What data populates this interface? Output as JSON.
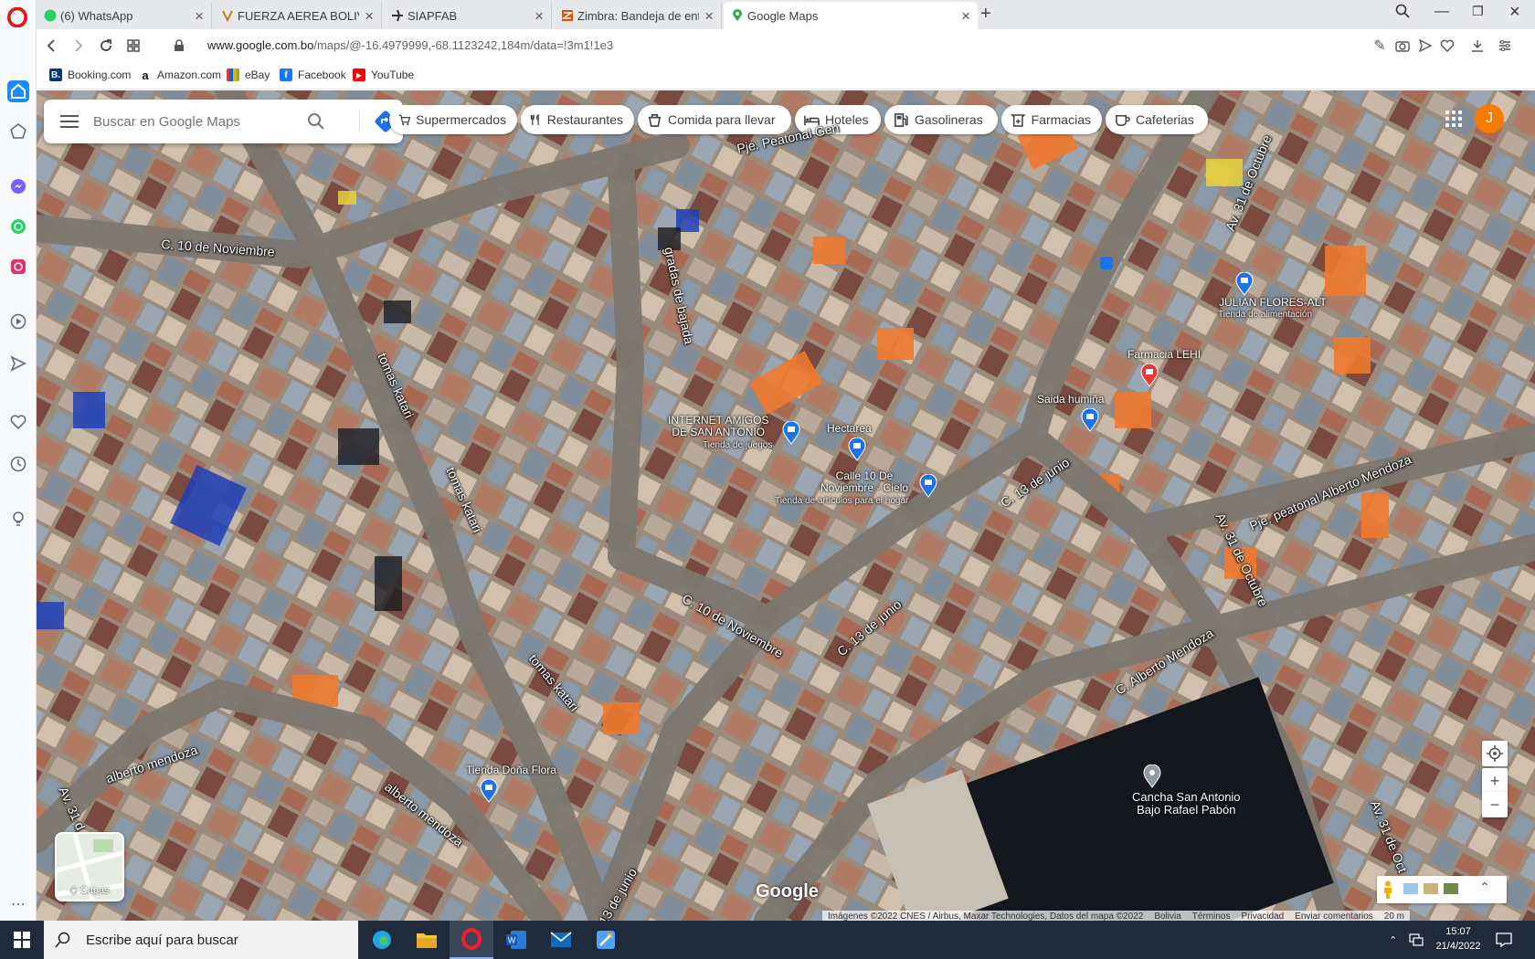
{
  "browser": {
    "tabs": [
      {
        "title": "(6) WhatsApp",
        "badge": "6"
      },
      {
        "title": "FUERZA AEREA BOLIVIANA"
      },
      {
        "title": "SIAPFAB"
      },
      {
        "title": "Zimbra: Bandeja de entrada"
      },
      {
        "title": "Google Maps"
      }
    ],
    "url_host": "www.google.com.bo",
    "url_path": "/maps/@-16.4979999,-68.1123242,184m/data=!3m1!1e3",
    "bookmarks": [
      "Booking.com",
      "Amazon.com",
      "eBay",
      "Facebook",
      "YouTube"
    ]
  },
  "maps": {
    "search_placeholder": "Buscar en Google Maps",
    "chips": [
      "Supermercados",
      "Restaurantes",
      "Comida para llevar",
      "Hoteles",
      "Gasolineras",
      "Farmacias",
      "Cafeterias"
    ],
    "avatar_letter": "J",
    "streets": {
      "pje_peatonal_top": "Pje. Peatonal Gen",
      "c10_nov_top": "C. 10 de Noviembre",
      "gradas": "gradas de bajada",
      "tomas1": "tomas katari",
      "tomas2": "tomas katari",
      "tomas3": "tomas katari",
      "av31_top": "Av. 31 de Octubre",
      "av31_mid": "Av. 31 de Octubre",
      "av31_right": "Av. 31 de Oct",
      "av31_left": "Av. 31 d",
      "c13_a": "C. 13 de junio",
      "c13_b": "C. 13 de junio",
      "c13_bottom": "13 de junio",
      "c10_nov_mid": "C. 10 de Noviembre",
      "pje_alberto": "Pje. peatonal Alberto Mendoza",
      "c_alberto": "C. Alberto Mendoza",
      "alberto1": "alberto mendoza",
      "alberto2": "alberto mendoza"
    },
    "pois": {
      "julian": "JULIAN FLORES-ALT",
      "julian_sub": "Tienda de alimentación",
      "farmacia": "Farmacia LEHI",
      "saida": "Saida humiña",
      "internet_l1": "INTERNET AMIGOS",
      "internet_l2": "DE SAN ANTONIO",
      "internet_sub": "Tienda de juegos",
      "hectarea": "Hectarea",
      "calle10_l1": "Calle 10 De",
      "calle10_l2": "Noviembre - Cielo",
      "calle10_sub": "Tienda de artículos para el hogar",
      "dona_flora": "Tienda Doña Flora",
      "cancha_l1": "Cancha San Antonio",
      "cancha_l2": "Bajo Rafael Pabón"
    },
    "layers_label": "Capas",
    "logo": "Google",
    "attribution": [
      "Imágenes ©2022 CNES / Airbus, Maxar Technologies, Datos del mapa ©2022",
      "Bolivia",
      "Términos",
      "Privacidad",
      "Enviar comentarios",
      "20 m"
    ]
  },
  "taskbar": {
    "search_text": "Escribe aquí para buscar",
    "time": "15:07",
    "date": "21/4/2022"
  },
  "colors": {
    "opera_red": "#e0171f",
    "opera_blue": "#1a8cff",
    "avatar": "#f57c00",
    "maps_blue": "#1a73e8"
  }
}
